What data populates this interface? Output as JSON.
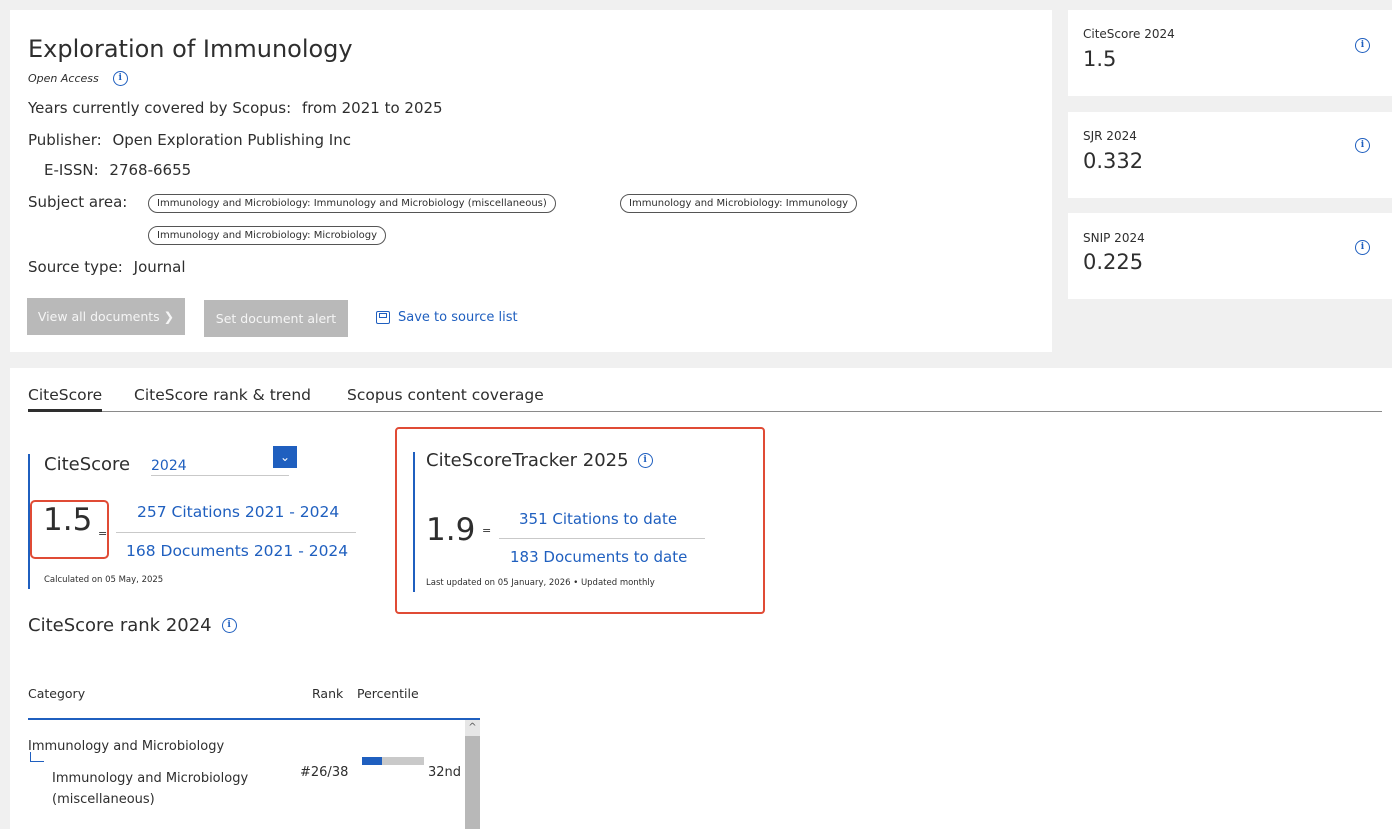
{
  "source": {
    "title": "Exploration of Immunology",
    "access": "Open Access",
    "years_label": "Years currently covered by Scopus:",
    "years_value": "from 2021 to 2025",
    "publisher_label": "Publisher:",
    "publisher_value": "Open Exploration Publishing Inc",
    "eissn_label": "E-ISSN:",
    "eissn_value": "2768-6655",
    "subject_label": "Subject area:",
    "subjects": [
      "Immunology and Microbiology: Immunology and Microbiology (miscellaneous)",
      "Immunology and Microbiology: Immunology",
      "Immunology and Microbiology: Microbiology"
    ],
    "type_label": "Source type:",
    "type_value": "Journal"
  },
  "actions": {
    "view_all": "View all documents ❯",
    "set_alert": "Set document alert",
    "save": "Save to source list"
  },
  "metrics": [
    {
      "label": "CiteScore 2024",
      "value": "1.5"
    },
    {
      "label": "SJR 2024",
      "value": "0.332"
    },
    {
      "label": "SNIP 2024",
      "value": "0.225"
    }
  ],
  "tabs": [
    "CiteScore",
    "CiteScore rank & trend",
    "Scopus content coverage"
  ],
  "citescore": {
    "title": "CiteScore",
    "year": "2024",
    "value": "1.5",
    "equals": "=",
    "citations": "257 Citations 2021 - 2024",
    "documents": "168 Documents 2021 - 2024",
    "note": "Calculated on 05 May, 2025"
  },
  "tracker": {
    "title": "CiteScoreTracker 2025",
    "value": "1.9",
    "equals": "=",
    "citations": "351 Citations to date",
    "documents": "183 Documents to date",
    "note": "Last updated on 05 January, 2026 • Updated monthly"
  },
  "rank": {
    "title": "CiteScore rank 2024",
    "headers": {
      "category": "Category",
      "rank": "Rank",
      "percentile": "Percentile"
    },
    "rows": [
      {
        "parent": "Immunology and Microbiology",
        "child_line1": "Immunology and Microbiology",
        "child_line2": "(miscellaneous)",
        "rank": "#26/38",
        "percentile_label": "32nd",
        "percentile_value": 32
      }
    ]
  },
  "colors": {
    "accent": "#1f5fbf",
    "highlight": "#e04b35",
    "button_disabled": "#b9b9b9"
  }
}
